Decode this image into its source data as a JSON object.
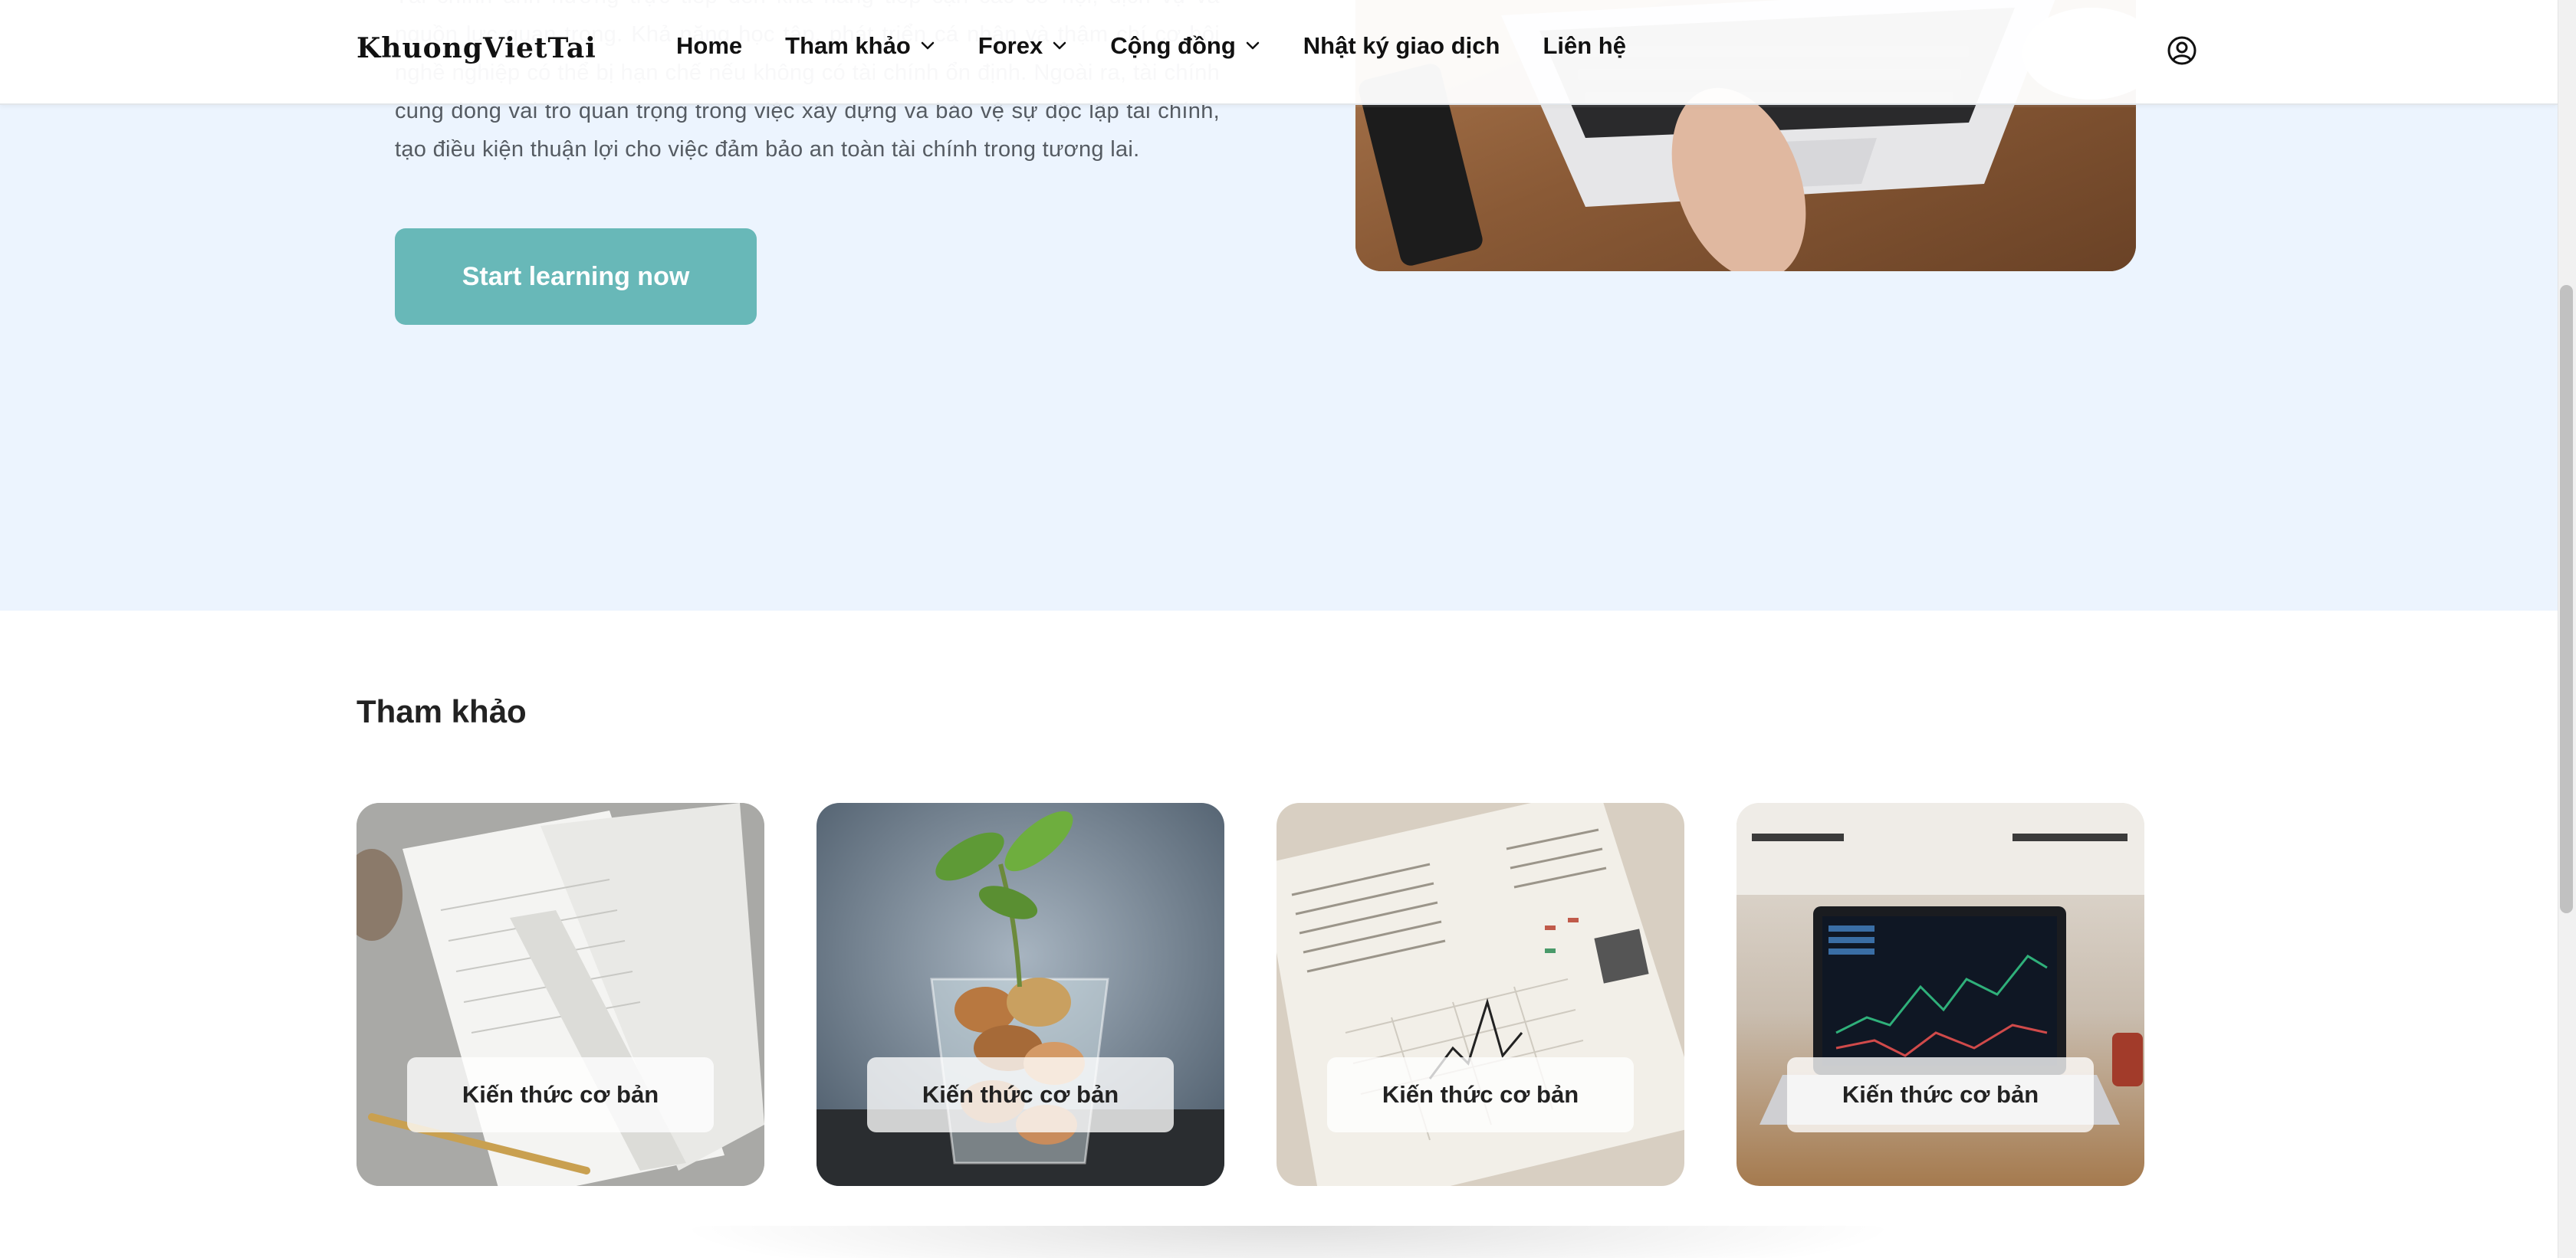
{
  "header": {
    "logo": "KhuongVietTai",
    "nav": [
      {
        "label": "Home",
        "dropdown": false
      },
      {
        "label": "Tham khảo",
        "dropdown": true
      },
      {
        "label": "Forex",
        "dropdown": true
      },
      {
        "label": "Cộng đồng",
        "dropdown": true
      },
      {
        "label": "Nhật ký giao dịch",
        "dropdown": false
      },
      {
        "label": "Liên hệ",
        "dropdown": false
      }
    ],
    "user_icon": "user-circle-icon"
  },
  "hero": {
    "paragraph": "Tài chính ảnh hưởng trực tiếp đến khả năng tiếp cận các cơ hội, dịch vụ và nguồn lực quan trọng. Khả năng học tập, phát triển cá nhân và thậm chí cơ hội nghề nghiệp có thể bị hạn chế nếu không có tài chính ổn định. Ngoài ra, tài chính cũng đóng vai trò quan trọng trong việc xây dựng và bảo vệ sự độc lập tài chính, tạo điều kiện thuận lợi cho việc đảm bảo an toàn tài chính trong tương lai.",
    "cta_label": "Start learning now"
  },
  "reference": {
    "title": "Tham khảo",
    "cards": [
      {
        "label": "Kiến thức cơ bản"
      },
      {
        "label": "Kiến thức cơ bản"
      },
      {
        "label": "Kiến thức cơ bản"
      },
      {
        "label": "Kiến thức cơ bản"
      }
    ]
  },
  "colors": {
    "hero_bg": "#ecf4fe",
    "cta_bg": "#68b8b8",
    "header_bg": "#ffffff"
  }
}
